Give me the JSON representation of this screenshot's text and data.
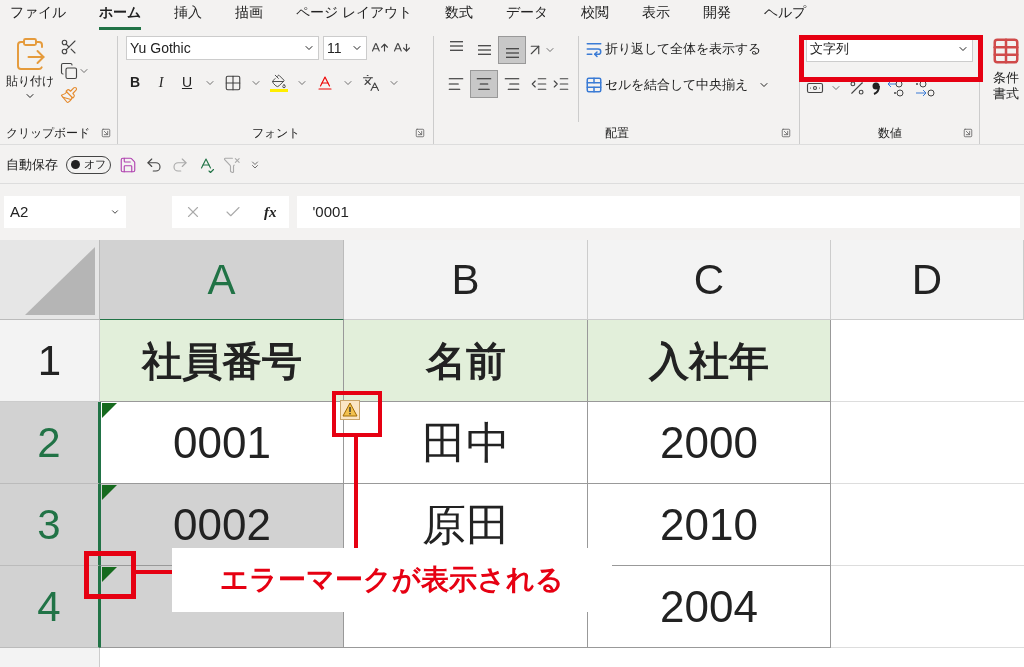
{
  "ribbon": {
    "tabs": [
      {
        "label": "ファイル",
        "selected": false
      },
      {
        "label": "ホーム",
        "selected": true
      },
      {
        "label": "挿入",
        "selected": false
      },
      {
        "label": "描画",
        "selected": false
      },
      {
        "label": "ページ レイアウト",
        "selected": false
      },
      {
        "label": "数式",
        "selected": false
      },
      {
        "label": "データ",
        "selected": false
      },
      {
        "label": "校閲",
        "selected": false
      },
      {
        "label": "表示",
        "selected": false
      },
      {
        "label": "開発",
        "selected": false
      },
      {
        "label": "ヘルプ",
        "selected": false
      }
    ],
    "clipboard": {
      "paste_label": "貼り付け",
      "group_label": "クリップボード"
    },
    "font": {
      "name": "Yu Gothic",
      "size": "11",
      "style_buttons": [
        "B",
        "I",
        "U"
      ],
      "group_label": "フォント"
    },
    "alignment": {
      "vertical": [
        {
          "selected": false
        },
        {
          "selected": false
        },
        {
          "selected": true
        }
      ],
      "horizontal": [
        {
          "selected": false
        },
        {
          "selected": true
        },
        {
          "selected": false
        }
      ],
      "wrap_label": "折り返して全体を表示する",
      "merge_label": "セルを結合して中央揃え",
      "group_label": "配置"
    },
    "number": {
      "format": "文字列",
      "group_label": "数値"
    },
    "styles": {
      "label_top": "条件",
      "label_bottom": "書式"
    }
  },
  "quick_access": {
    "autosave_label": "自動保存",
    "toggle_label": "オフ",
    "autosave_on": false
  },
  "formula_bar": {
    "name_box": "A2",
    "fx_label": "fx",
    "formula": "'0001"
  },
  "sheet": {
    "columns": [
      {
        "label": "A",
        "selected": true
      },
      {
        "label": "B",
        "selected": false
      },
      {
        "label": "C",
        "selected": false
      },
      {
        "label": "D",
        "selected": false
      }
    ],
    "rows": [
      {
        "label": "1",
        "selected": false,
        "cells": [
          {
            "text": "社員番号",
            "kind": "header",
            "selected": false
          },
          {
            "text": "名前",
            "kind": "header",
            "selected": false
          },
          {
            "text": "入社年",
            "kind": "header",
            "selected": false
          }
        ]
      },
      {
        "label": "2",
        "selected": true,
        "cells": [
          {
            "text": "0001",
            "kind": "data",
            "selected": false,
            "error": true
          },
          {
            "text": "田中",
            "kind": "data",
            "selected": false
          },
          {
            "text": "2000",
            "kind": "data",
            "selected": false
          }
        ]
      },
      {
        "label": "3",
        "selected": true,
        "cells": [
          {
            "text": "0002",
            "kind": "data",
            "selected": true,
            "error": true
          },
          {
            "text": "原田",
            "kind": "data",
            "selected": false
          },
          {
            "text": "2010",
            "kind": "data",
            "selected": false
          }
        ]
      },
      {
        "label": "4",
        "selected": true,
        "cells": [
          {
            "kind": "data",
            "selected": true,
            "error": true
          },
          {
            "kind": "data",
            "selected": false
          },
          {
            "text": "2004",
            "kind": "data",
            "selected": false
          }
        ]
      }
    ]
  },
  "annotation": {
    "callout": "エラーマークが表示される"
  }
}
